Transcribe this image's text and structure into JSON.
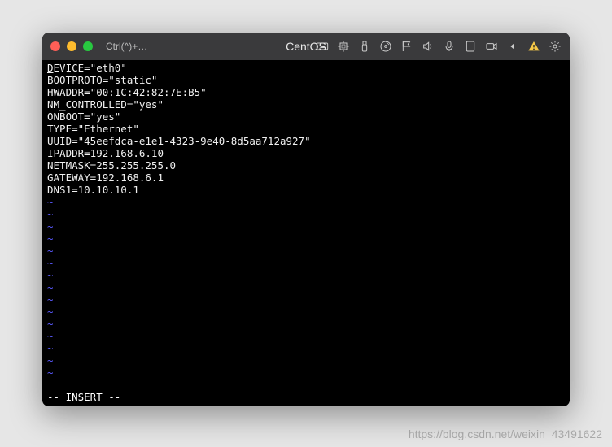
{
  "window": {
    "shortcut_hint": "Ctrl(^)+…",
    "title": "CentOS"
  },
  "toolbar_icons": {
    "keyboard": "keyboard-icon",
    "cpu": "cpu-icon",
    "usb": "usb-icon",
    "disc": "disc-icon",
    "flag": "flag-icon",
    "sound": "sound-icon",
    "mic": "mic-icon",
    "tablet": "tablet-icon",
    "camera": "camera-icon",
    "back": "back-icon",
    "warning": "warning-icon",
    "gear": "gear-icon"
  },
  "file": {
    "lines": [
      "DEVICE=\"eth0\"",
      "BOOTPROTO=\"static\"",
      "HWADDR=\"00:1C:42:82:7E:B5\"",
      "NM_CONTROLLED=\"yes\"",
      "ONBOOT=\"yes\"",
      "TYPE=\"Ethernet\"",
      "UUID=\"45eefdca-e1e1-4323-9e40-8d5aa712a927\"",
      "IPADDR=192.168.6.10",
      "NETMASK=255.255.255.0",
      "GATEWAY=192.168.6.1",
      "DNS1=10.10.10.1"
    ],
    "tilde": "~",
    "tilde_count": 15
  },
  "status_line": "-- INSERT --",
  "watermark": "https://blog.csdn.net/weixin_43491622"
}
